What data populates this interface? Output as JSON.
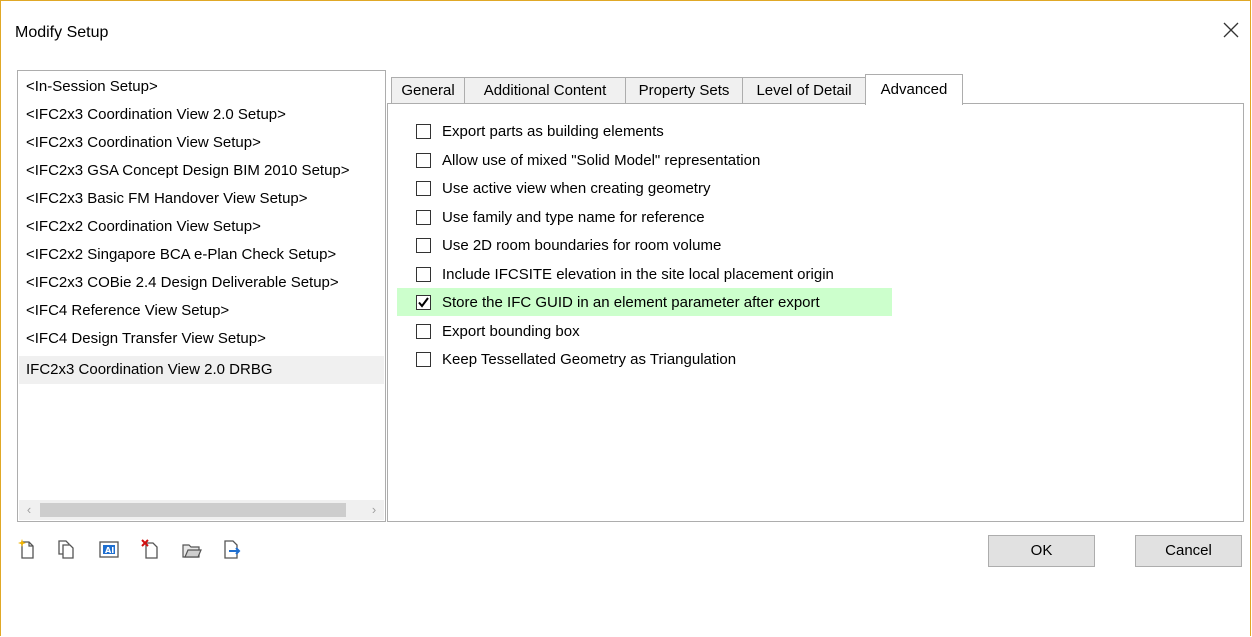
{
  "window": {
    "title": "Modify Setup"
  },
  "setups": [
    "<In-Session Setup>",
    "<IFC2x3 Coordination View 2.0 Setup>",
    "<IFC2x3 Coordination View Setup>",
    "<IFC2x3 GSA Concept Design BIM 2010 Setup>",
    "<IFC2x3 Basic FM Handover View Setup>",
    "<IFC2x2 Coordination View Setup>",
    "<IFC2x2 Singapore BCA e-Plan Check Setup>",
    "<IFC2x3 COBie 2.4 Design Deliverable Setup>",
    "<IFC4 Reference View Setup>",
    "<IFC4 Design Transfer View Setup>",
    "IFC2x3 Coordination View 2.0 DRBG"
  ],
  "selected_setup": "IFC2x3 Coordination View 2.0 DRBG",
  "tabs": [
    "General",
    "Additional Content",
    "Property Sets",
    "Level of Detail",
    "Advanced"
  ],
  "active_tab": "Advanced",
  "options": [
    {
      "label": "Export parts as building elements",
      "checked": false
    },
    {
      "label": "Allow use of mixed \"Solid Model\" representation",
      "checked": false
    },
    {
      "label": "Use active view when creating geometry",
      "checked": false
    },
    {
      "label": "Use family and type name for reference",
      "checked": false
    },
    {
      "label": "Use 2D room boundaries for room volume",
      "checked": false
    },
    {
      "label": "Include IFCSITE elevation in the site local placement origin",
      "checked": false
    },
    {
      "label": "Store the IFC GUID in an element parameter after export",
      "checked": true
    },
    {
      "label": "Export bounding box",
      "checked": false
    },
    {
      "label": "Keep Tessellated Geometry as Triangulation",
      "checked": false
    }
  ],
  "highlight_color": "#ccffcc",
  "toolbar_icons": [
    "new-setup-icon",
    "duplicate-setup-icon",
    "rename-setup-icon",
    "delete-setup-icon",
    "import-setup-icon",
    "export-setup-icon"
  ],
  "buttons": {
    "ok": "OK",
    "cancel": "Cancel"
  }
}
